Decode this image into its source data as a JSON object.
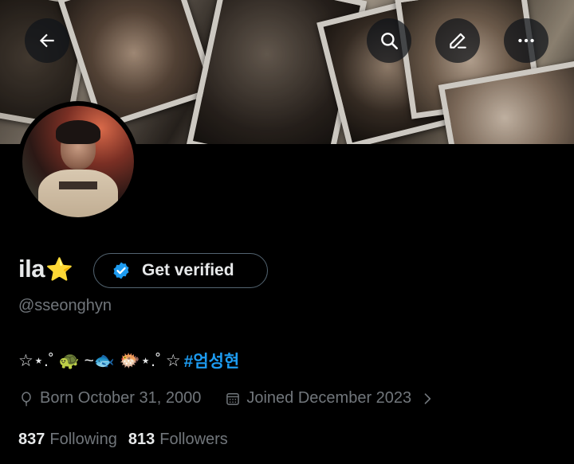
{
  "header": {
    "back_icon": "arrow-left-icon",
    "actions": [
      "search-icon",
      "pencil-icon",
      "more-horizontal-icon"
    ]
  },
  "profile": {
    "display_name": "ila",
    "name_emoji": "⭐",
    "handle": "@sseonghyn",
    "verify_label": "Get verified",
    "verify_badge_color": "#1d9bf0",
    "bio_symbols": "☆⋆.˚ 🐢 ~🐟 🐡⋆.˚ ☆",
    "bio_hashtag": "#엄성현",
    "birthday": "Born October 31, 2000",
    "joined": "Joined December 2023",
    "following_count": "837",
    "following_label": "Following",
    "followers_count": "813",
    "followers_label": "Followers"
  },
  "colors": {
    "background": "#000000",
    "text_primary": "#e7e9ea",
    "text_secondary": "#71767b",
    "accent": "#1d9bf0",
    "star": "#f8c43a"
  }
}
